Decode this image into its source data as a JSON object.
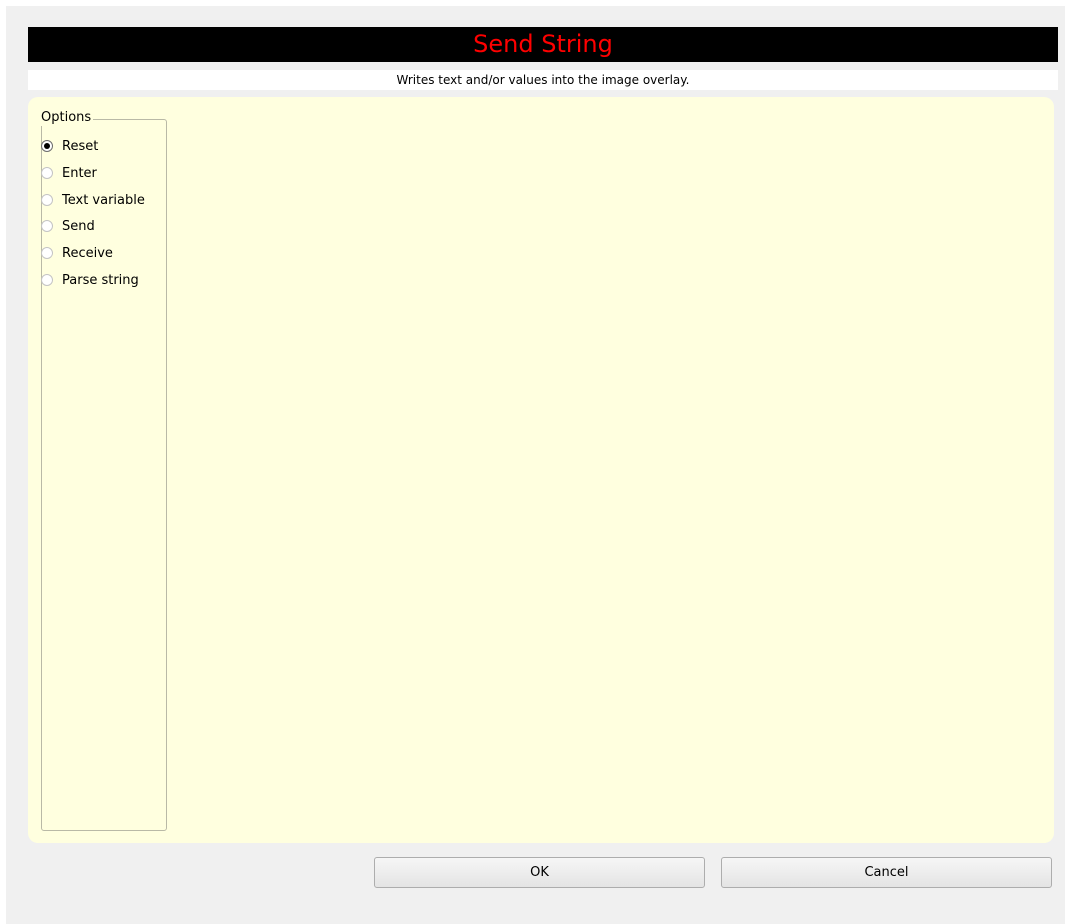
{
  "dialog": {
    "title": "Send String",
    "description": "Writes text and/or values into the image overlay."
  },
  "options": {
    "legend": "Options",
    "items": [
      {
        "label": "Reset",
        "checked": true
      },
      {
        "label": "Enter",
        "checked": false
      },
      {
        "label": "Text variable",
        "checked": false
      },
      {
        "label": "Send",
        "checked": false
      },
      {
        "label": "Receive",
        "checked": false
      },
      {
        "label": "Parse string",
        "checked": false
      }
    ]
  },
  "buttons": {
    "ok_label": "OK",
    "cancel_label": "Cancel"
  },
  "colors": {
    "title_background": "#000000",
    "title_text": "#ff0000",
    "panel_background": "#ffffdf",
    "dialog_background": "#f0f0f0"
  }
}
